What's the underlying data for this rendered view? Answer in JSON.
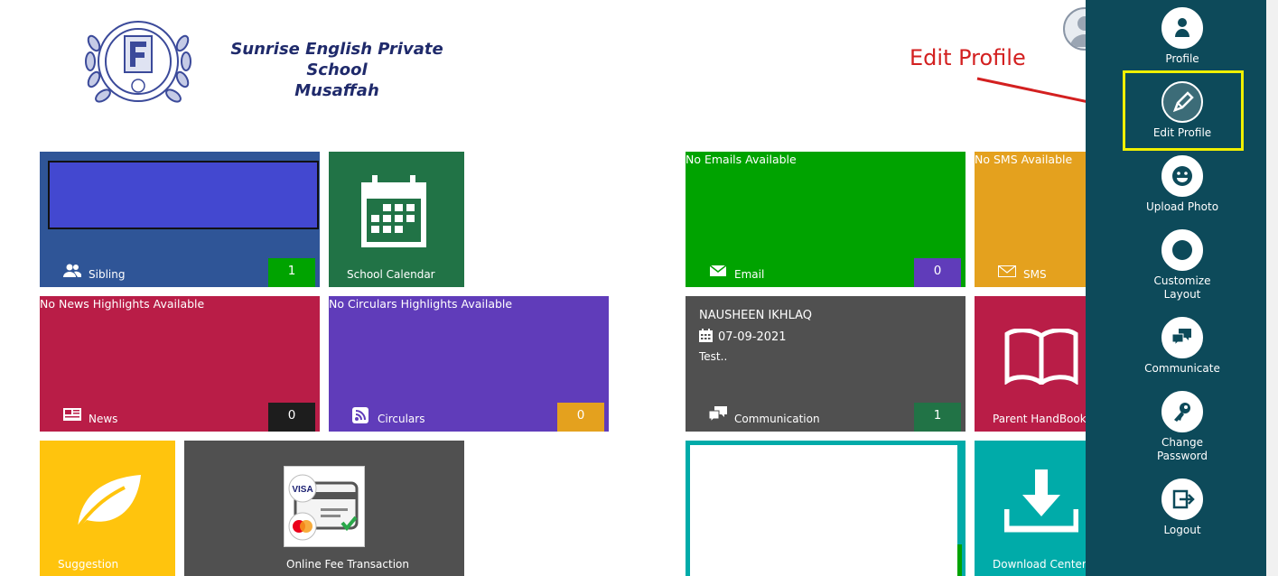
{
  "header": {
    "school_name_line1": "Sunrise English Private School",
    "school_name_line2": "Musaffah",
    "annotation": "Edit Profile"
  },
  "tiles": {
    "sibling": {
      "label": "Sibling",
      "count": "1"
    },
    "calendar": {
      "label": "School Calendar"
    },
    "email": {
      "headline": "No Emails Available",
      "label": "Email",
      "count": "0"
    },
    "sms": {
      "headline": "No SMS Available",
      "label": "SMS"
    },
    "news": {
      "headline": "No News Highlights Available",
      "label": "News",
      "count": "0"
    },
    "circulars": {
      "headline": "No Circulars Highlights Available",
      "label": "Circulars",
      "count": "0"
    },
    "communication": {
      "sender": "NAUSHEEN IKHLAQ",
      "date": "07-09-2021",
      "message": "Test..",
      "label": "Communication",
      "count": "1"
    },
    "handbook": {
      "label": "Parent HandBook"
    },
    "suggestion": {
      "label": "Suggestion"
    },
    "fee": {
      "label": "Online Fee Transaction",
      "card1": "VISA"
    },
    "download": {
      "label": "Download Center"
    }
  },
  "panel": {
    "items": [
      {
        "label": "Profile",
        "icon": "user-icon"
      },
      {
        "label": "Edit Profile",
        "icon": "pencil-icon"
      },
      {
        "label": "Upload Photo",
        "icon": "smiley-icon"
      },
      {
        "label_line1": "Customize",
        "label_line2": "Layout",
        "icon": "layout-icon"
      },
      {
        "label": "Communicate",
        "icon": "chat-icon"
      },
      {
        "label_line1": "Change",
        "label_line2": "Password",
        "icon": "key-icon"
      },
      {
        "label": "Logout",
        "icon": "logout-icon"
      }
    ]
  },
  "colors": {
    "panel": "#0d4a5a",
    "sibling": "#2f5597",
    "calendar": "#217346",
    "email": "#00a300",
    "sms": "#e4a11e",
    "news": "#b91d47",
    "circulars": "#603cba",
    "communication": "#505050",
    "handbook": "#b91d47",
    "suggestion": "#ffc40d",
    "fee": "#505050",
    "download": "#00aba9",
    "annotation": "#d32020",
    "highlight": "#f0f000"
  }
}
